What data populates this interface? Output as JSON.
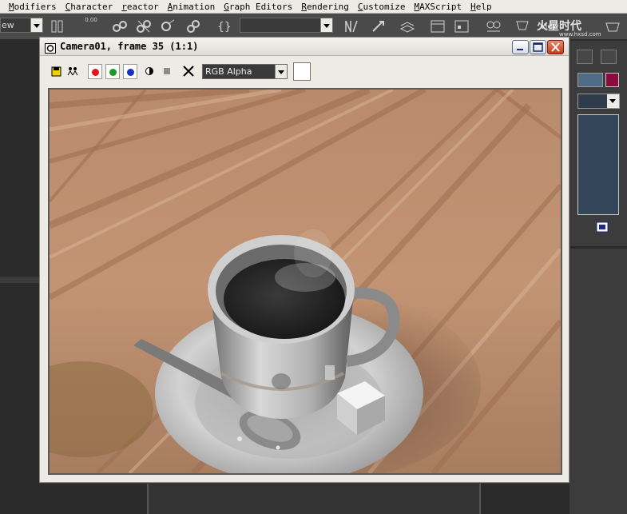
{
  "menubar": {
    "items": [
      "Modifiers",
      "Character",
      "reactor",
      "Animation",
      "Graph Editors",
      "Rendering",
      "Customize",
      "MAXScript",
      "Help"
    ]
  },
  "toolbar": {
    "view_select_value": "ew",
    "spinner_value": "0.00",
    "viewport_label": "View"
  },
  "watermark": {
    "text": "火星时代",
    "url": "www.hxsd.com"
  },
  "render_window": {
    "title": "Camera01, frame 35 (1:1)",
    "channel_select_value": "RGB Alpha",
    "channels": [
      {
        "name": "red",
        "color": "#e8141c"
      },
      {
        "name": "green",
        "color": "#1c9a28"
      },
      {
        "name": "blue",
        "color": "#1430c8"
      }
    ],
    "swatch_color": "#ffffff",
    "image_description_icon": "rendered-image"
  },
  "right_panel": {
    "swatch_color": "#8a0c3c"
  }
}
